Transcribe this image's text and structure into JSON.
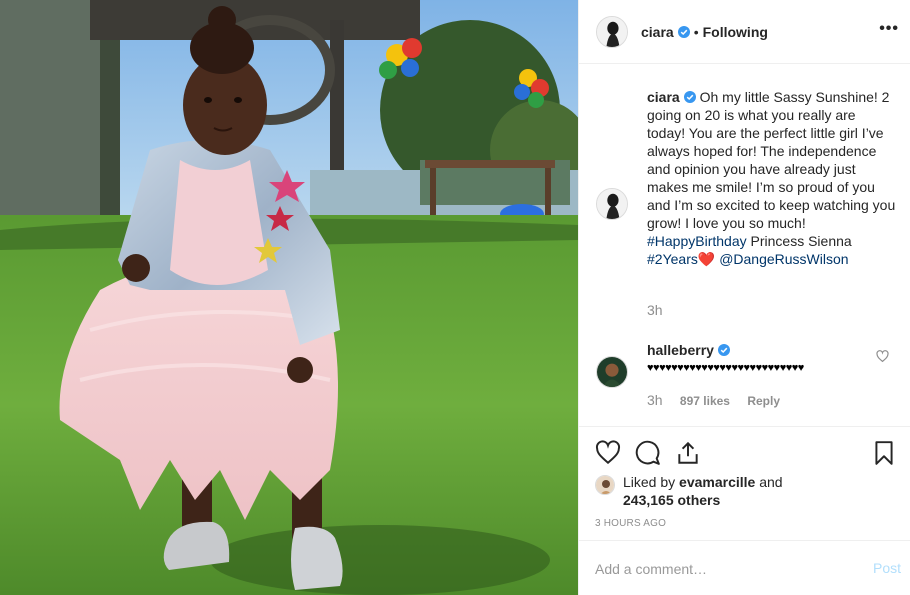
{
  "header": {
    "username": "ciara",
    "follow_status": "Following",
    "separator": "•",
    "more_icon": "ellipsis-icon",
    "verified": true
  },
  "caption": {
    "username": "ciara",
    "text_1": " Oh my little Sassy Sunshine! 2 going on 20 is what you really are today! You are the perfect little girl I’ve always hoped for! The independence and opinion you have already just makes me smile! I’m so proud of you and I’m so excited to keep watching you grow! I love you so much! ",
    "hashtag_1": "#HappyBirthday",
    "text_2": " Princess Sienna ",
    "hashtag_2": "#2Years",
    "heart": "❤️",
    "mention": "@DangeRussWilson",
    "time": "3h"
  },
  "comment": {
    "username": "halleberry",
    "text": "♥♥♥♥♥♥♥♥♥♥♥♥♥♥♥♥♥♥♥♥♥♥♥♥♥♥",
    "time": "3h",
    "likes": "897 likes",
    "reply": "Reply"
  },
  "actions": {
    "icons": [
      "heart-icon",
      "comment-icon",
      "share-icon",
      "bookmark-icon"
    ]
  },
  "likes": {
    "prefix": "Liked by ",
    "liker": "evamarcille",
    "middle": " and",
    "count": "243,165 others"
  },
  "timestamp": "3 HOURS AGO",
  "add_comment": {
    "placeholder": "Add a comment…",
    "post_label": "Post"
  },
  "colors": {
    "link": "#003569",
    "muted": "#8e8e8e",
    "verified": "#3897f0",
    "post_disabled": "#b2dffc"
  }
}
